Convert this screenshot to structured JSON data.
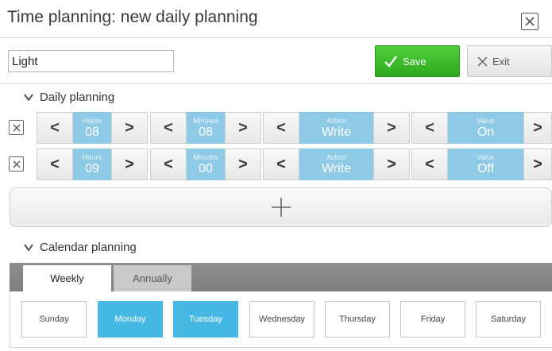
{
  "window": {
    "title": "Time planning: new daily planning"
  },
  "form": {
    "name_value": "Light"
  },
  "toolbar": {
    "save_label": "Save",
    "exit_label": "Exit"
  },
  "daily": {
    "header": "Daily planning",
    "rows": [
      {
        "hours_label": "Hours",
        "hours": "08",
        "minutes_label": "Minutes",
        "minutes": "08",
        "action_label": "Action",
        "action": "Write",
        "value_label": "Value",
        "value": "On"
      },
      {
        "hours_label": "Hours",
        "hours": "09",
        "minutes_label": "Minutes",
        "minutes": "00",
        "action_label": "Action",
        "action": "Write",
        "value_label": "Value",
        "value": "Off"
      }
    ],
    "add_symbol": "+"
  },
  "calendar": {
    "header": "Calendar planning",
    "tabs": [
      {
        "label": "Weekly",
        "active": true
      },
      {
        "label": "Annually",
        "active": false
      }
    ],
    "days": [
      {
        "label": "Sunday",
        "selected": false
      },
      {
        "label": "Monday",
        "selected": true
      },
      {
        "label": "Tuesday",
        "selected": true
      },
      {
        "label": "Wednesday",
        "selected": false
      },
      {
        "label": "Thursday",
        "selected": false
      },
      {
        "label": "Friday",
        "selected": false
      },
      {
        "label": "Saturday",
        "selected": false
      }
    ]
  },
  "glyphs": {
    "prev": "<",
    "next": ">"
  },
  "colors": {
    "save_green": "#3cbf2b",
    "value_blue": "#8ec9e6",
    "day_selected": "#45b8e5"
  }
}
